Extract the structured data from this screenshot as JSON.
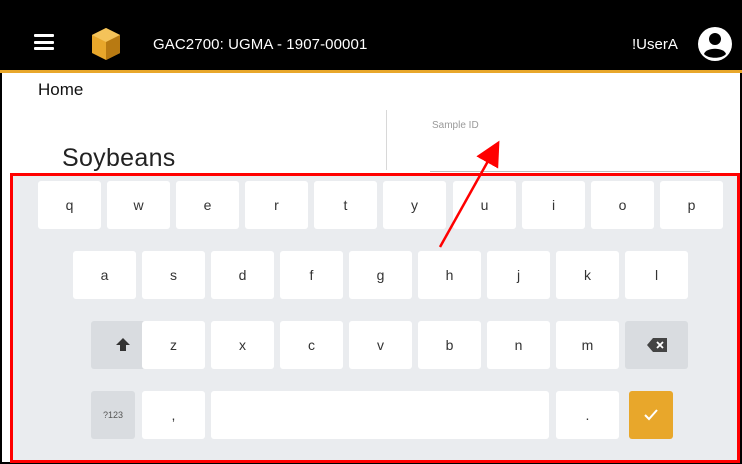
{
  "header": {
    "app_title": "GAC2700: UGMA - 1907-00001",
    "user_name": "!UserA"
  },
  "breadcrumb": "Home",
  "main": {
    "product_title": "Soybeans",
    "sample_id_label": "Sample ID",
    "sample_id_value": ""
  },
  "keyboard": {
    "row1": [
      "q",
      "w",
      "e",
      "r",
      "t",
      "y",
      "u",
      "i",
      "o",
      "p"
    ],
    "row2": [
      "a",
      "s",
      "d",
      "f",
      "g",
      "h",
      "j",
      "k",
      "l"
    ],
    "row3": [
      "z",
      "x",
      "c",
      "v",
      "b",
      "n",
      "m"
    ],
    "numbers_label": "?123",
    "comma_label": ",",
    "period_label": ".",
    "shift_icon": "shift-arrow-icon",
    "backspace_icon": "backspace-icon",
    "enter_icon": "checkmark-icon"
  },
  "colors": {
    "header_bg": "#000000",
    "accent": "#e8a72b",
    "highlight": "#ff0000",
    "keyboard_bg": "#eaecef"
  }
}
